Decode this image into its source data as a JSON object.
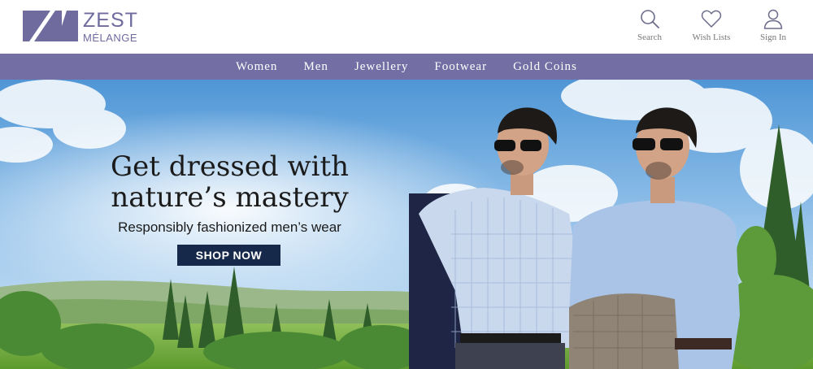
{
  "brand": {
    "line1": "ZEST",
    "line2": "MÉLANGE",
    "color": "#6f6b9f"
  },
  "header_actions": [
    {
      "label": "Search",
      "icon": "search-icon"
    },
    {
      "label": "Wish Lists",
      "icon": "heart-icon"
    },
    {
      "label": "Sign In",
      "icon": "user-icon"
    }
  ],
  "nav": {
    "background": "#736ea3",
    "items": [
      {
        "label": "Women"
      },
      {
        "label": "Men"
      },
      {
        "label": "Jewellery"
      },
      {
        "label": "Footwear"
      },
      {
        "label": "Gold Coins"
      }
    ]
  },
  "hero": {
    "title_line1": "Get dressed with",
    "title_line2": "nature’s mastery",
    "subtitle": "Responsibly fashionized men’s wear",
    "cta": "SHOP NOW",
    "cta_color": "#17294b"
  }
}
